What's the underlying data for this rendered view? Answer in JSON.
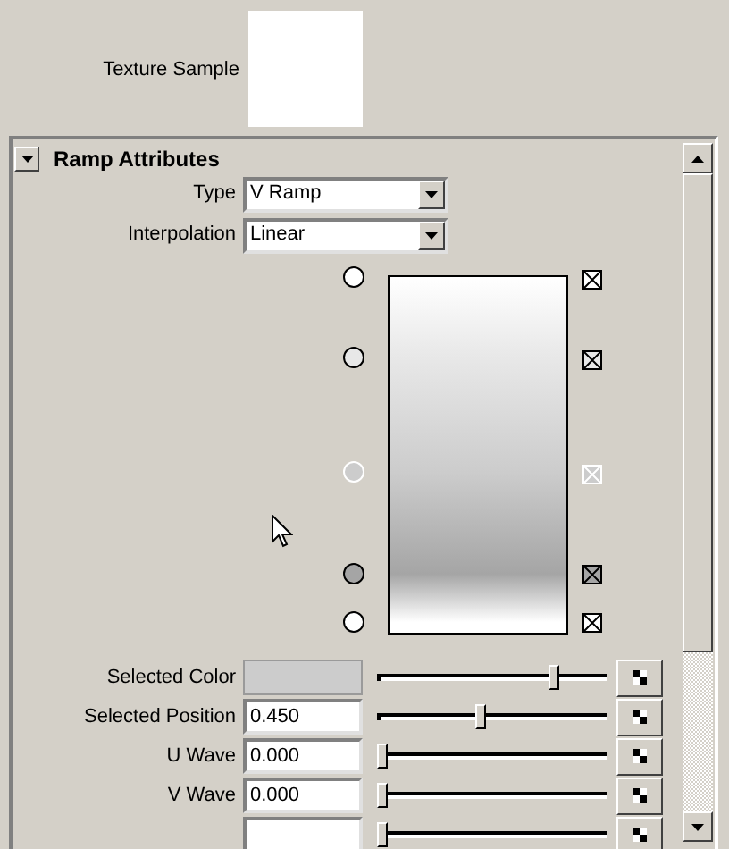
{
  "texture_sample": {
    "label": "Texture Sample"
  },
  "section": {
    "title": "Ramp Attributes",
    "expanded": true
  },
  "dropdowns": [
    {
      "label": "Type",
      "value": "V Ramp"
    },
    {
      "label": "Interpolation",
      "value": "Linear"
    }
  ],
  "ramp": {
    "handles": [
      {
        "level": 1.0,
        "color": "#ffffff",
        "selected": false
      },
      {
        "level": 0.775,
        "color": "#e8e8e8",
        "selected": false
      },
      {
        "level": 0.45,
        "color": "#cccccc",
        "selected": true
      },
      {
        "level": 0.165,
        "color": "#a5a5a5",
        "selected": false
      },
      {
        "level": 0.03,
        "color": "#ffffff",
        "selected": false
      }
    ]
  },
  "rows": [
    {
      "kind": "color",
      "label": "Selected Color",
      "color": "#cccccc",
      "level": 0.78
    },
    {
      "kind": "number",
      "label": "Selected Position",
      "value": "0.450",
      "level": 0.45
    },
    {
      "kind": "number",
      "label": "U Wave",
      "value": "0.000",
      "level": 0.0
    },
    {
      "kind": "number",
      "label": "V Wave",
      "value": "0.000",
      "level": 0.0
    },
    {
      "kind": "partial",
      "level": 0.0
    }
  ]
}
